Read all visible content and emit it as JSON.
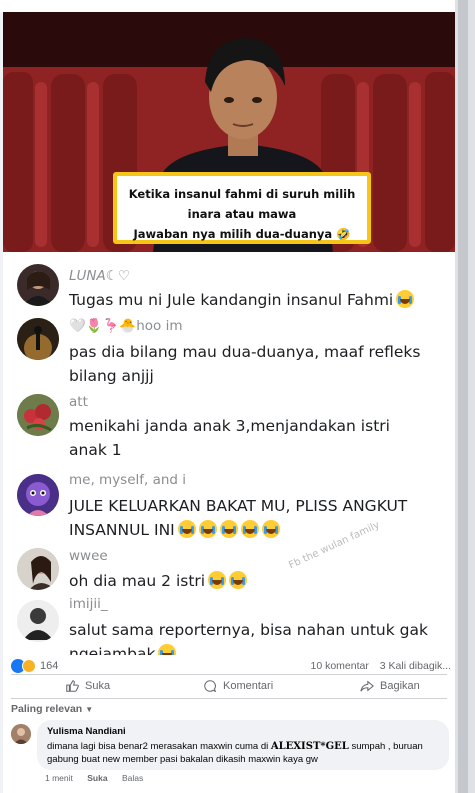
{
  "video": {
    "caption_line1": "Ketika insanul fahmi di suruh milih",
    "caption_line2": "inara atau mawa",
    "caption_line3": "Jawaban nya milih dua-duanya 🤣"
  },
  "comments": [
    {
      "name": "LUNA☾♡",
      "lines": [
        "Tugas mu ni Jule kandangin insanul Fahmi"
      ],
      "emoji_count": 1
    },
    {
      "name": "🤍🌷🦩🐣hoo im",
      "lines": [
        "pas dia bilang mau dua-duanya, maaf refleks",
        "bilang anjjj"
      ],
      "emoji_count": 0
    },
    {
      "name": "att",
      "lines": [
        "menikahi janda anak 3,menjandakan istri",
        "anak 1"
      ],
      "emoji_count": 0
    },
    {
      "name": "me, myself, and i",
      "lines": [
        "JULE KELUARKAN BAKAT MU, PLISS ANGKUT",
        "INSANNUL INI"
      ],
      "emoji_count": 5
    },
    {
      "name": "wwee",
      "lines": [
        "oh dia mau 2 istri"
      ],
      "emoji_count": 2
    },
    {
      "name": "imijii_",
      "lines": [
        "salut sama reporternya, bisa nahan untuk gak",
        "ngejambak"
      ],
      "emoji_count": 1
    }
  ],
  "watermark": "Fb the wulan family",
  "fb": {
    "reaction_count": "164",
    "comment_count": "10 komentar",
    "share_count": "3 Kali dibagik...",
    "like_label": "Suka",
    "comment_label": "Komentari",
    "share_label": "Bagikan",
    "sort_label": "Paling relevan",
    "comment": {
      "author": "Yulisma Nandiani",
      "text_before": "dimana lagi bisa benar2 merasakan maxwin cuma di ",
      "text_brand": "ALEXIST*GEL",
      "text_after": " sumpah , buruan gabung buat new member pasi bakalan dikasih maxwin kaya gw",
      "time": "1 menit",
      "like": "Suka",
      "reply": "Balas"
    }
  },
  "colors": {
    "accent": "#1877f2",
    "caption_border": "#f5c518",
    "video_bg": "#7a1f1f"
  }
}
